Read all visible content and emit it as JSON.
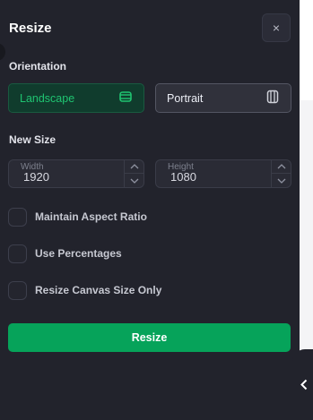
{
  "dialog": {
    "title": "Resize",
    "close_label": "×"
  },
  "orientation": {
    "label": "Orientation",
    "options": [
      {
        "label": "Landscape",
        "selected": true,
        "icon": "landscape-icon"
      },
      {
        "label": "Portrait",
        "selected": false,
        "icon": "portrait-icon"
      }
    ]
  },
  "size": {
    "label": "New Size",
    "width": {
      "label": "Width",
      "value": "1920"
    },
    "height": {
      "label": "Height",
      "value": "1080"
    }
  },
  "options": [
    {
      "label": "Maintain Aspect Ratio",
      "checked": false
    },
    {
      "label": "Use Percentages",
      "checked": false
    },
    {
      "label": "Resize Canvas Size Only",
      "checked": false
    }
  ],
  "actions": {
    "resize_label": "Resize"
  },
  "colors": {
    "panel_bg": "#22232c",
    "accent_green": "#06a35a",
    "selected_text": "#1fc471"
  },
  "icons": {
    "close": "close-icon",
    "stepper_up": "chevron-up-icon",
    "stepper_down": "chevron-down-icon",
    "collapse": "chevron-left-icon"
  }
}
